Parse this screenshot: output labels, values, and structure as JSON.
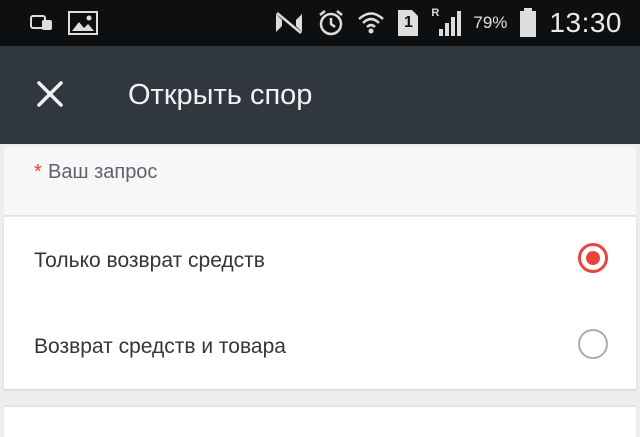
{
  "status_bar": {
    "battery_percent": "79%",
    "time": "13:30",
    "sim_slot": "1",
    "signal_label": "R",
    "icons": [
      "message-icon",
      "gallery-icon",
      "mute-icon",
      "alarm-icon",
      "wifi-icon",
      "sim-icon",
      "signal-icon",
      "battery-icon"
    ]
  },
  "app_bar": {
    "title": "Открыть спор",
    "close_icon": "close-icon",
    "background": "#31373e"
  },
  "form": {
    "request_label": "Ваш запрос",
    "required_mark": "*",
    "options": [
      {
        "label": "Только возврат средств",
        "selected": true
      },
      {
        "label": "Возврат средств и товара",
        "selected": false
      }
    ],
    "accent_color": "#e8463b"
  }
}
